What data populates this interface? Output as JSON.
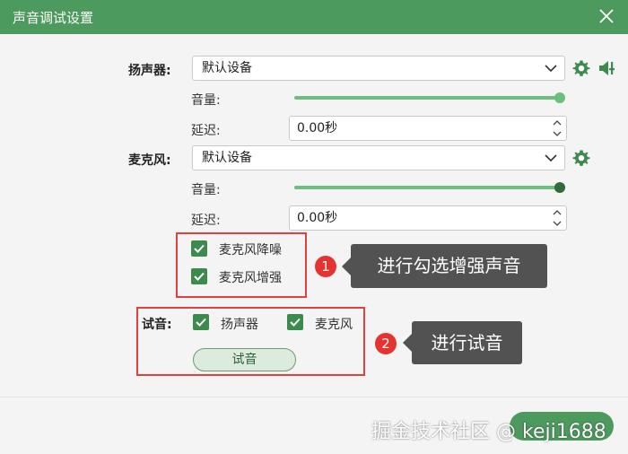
{
  "window": {
    "title": "声音调试设置"
  },
  "speaker": {
    "label": "扬声器:",
    "device": "默认设备",
    "volume_label": "音量:",
    "volume_level": 1.0,
    "delay_label": "延迟:",
    "delay_value": "0.00秒"
  },
  "mic": {
    "label": "麦克风:",
    "device": "默认设备",
    "volume_label": "音量:",
    "volume_level": 1.0,
    "delay_label": "延迟:",
    "delay_value": "0.00秒",
    "options": [
      {
        "label": "麦克风降噪",
        "checked": true
      },
      {
        "label": "麦克风增强",
        "checked": true
      }
    ]
  },
  "test": {
    "label": "试音:",
    "options": [
      {
        "label": "扬声器",
        "checked": true
      },
      {
        "label": "麦克风",
        "checked": true
      }
    ],
    "button_label": "试音"
  },
  "annotations": [
    {
      "number": "1",
      "text": "进行勾选增强声音"
    },
    {
      "number": "2",
      "text": "进行试音"
    }
  ],
  "watermark": "掘金技术社区 @ keji1688",
  "colors": {
    "accent": "#4d9a5e",
    "slider": "#6cc07e",
    "annotation_red": "#e0413c"
  }
}
